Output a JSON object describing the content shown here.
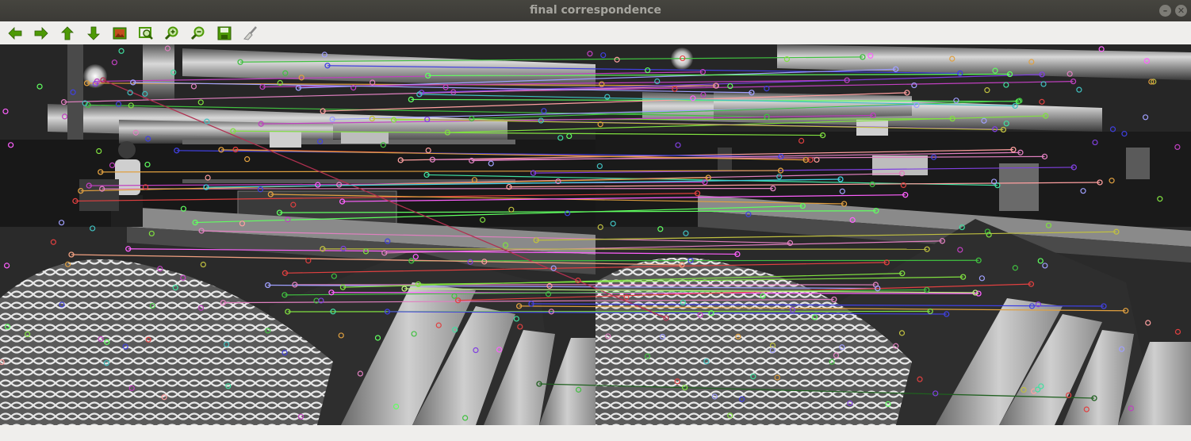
{
  "window": {
    "title": "final correspondence",
    "minimize_icon": "minus-icon",
    "close_icon": "close-icon"
  },
  "toolbar": {
    "buttons": [
      {
        "name": "pan-left-button",
        "icon": "arrow-left-icon"
      },
      {
        "name": "pan-right-button",
        "icon": "arrow-right-icon"
      },
      {
        "name": "pan-up-button",
        "icon": "arrow-up-icon"
      },
      {
        "name": "pan-down-button",
        "icon": "arrow-down-icon"
      },
      {
        "name": "zoom-fit-button",
        "icon": "picture-icon"
      },
      {
        "name": "zoom-original-button",
        "icon": "zoom-1-to-1-icon"
      },
      {
        "name": "zoom-in-button",
        "icon": "zoom-in-icon"
      },
      {
        "name": "zoom-out-button",
        "icon": "zoom-out-icon"
      },
      {
        "name": "save-button",
        "icon": "save-icon"
      },
      {
        "name": "properties-button",
        "icon": "brush-icon"
      }
    ]
  },
  "colors": {
    "titlebar": "#3b3a36",
    "title_text": "#a6a59f",
    "toolbar_bg": "#efeeec",
    "icon_green": "#4e9a06",
    "canvas_bg": "#0c0c0c"
  },
  "image": {
    "description_panels": [
      "left-image",
      "right-image"
    ],
    "match_count": 60
  }
}
